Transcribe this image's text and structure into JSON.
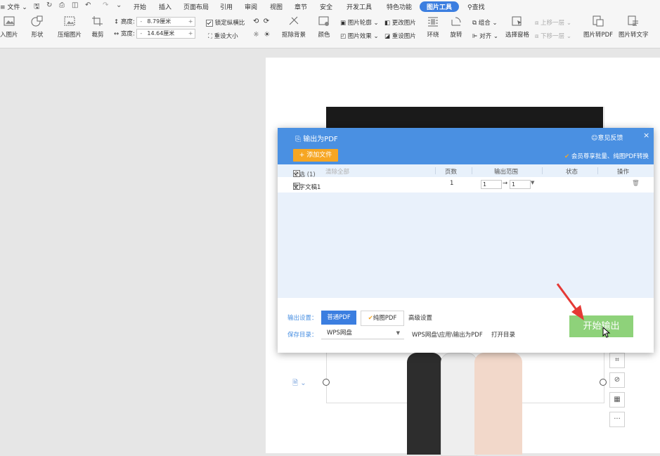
{
  "ribbon": {
    "tabs": [
      {
        "label": "文件"
      },
      {
        "label": "开始"
      },
      {
        "label": "插入"
      },
      {
        "label": "页面布局"
      },
      {
        "label": "引用"
      },
      {
        "label": "审阅"
      },
      {
        "label": "视图"
      },
      {
        "label": "章节"
      },
      {
        "label": "安全"
      },
      {
        "label": "开发工具"
      },
      {
        "label": "特色功能"
      },
      {
        "label": "图片工具"
      }
    ],
    "search_label": "查找",
    "buttons": [
      {
        "label": "入图片"
      },
      {
        "label": "形状"
      },
      {
        "label": "压缩图片"
      },
      {
        "label": "裁剪"
      },
      {
        "label": "抠除背景"
      },
      {
        "label": "颜色"
      },
      {
        "label": "环绕"
      },
      {
        "label": "旋转"
      },
      {
        "label": "选择窗格"
      },
      {
        "label": "图片转PDF"
      },
      {
        "label": "图片转文字"
      }
    ],
    "height_label": "高度:",
    "height_value": "8.79厘米",
    "width_label": "宽度:",
    "width_value": "14.64厘米",
    "lock_ratio_label": "锁定纵横比",
    "reset_size_label": "重设大小",
    "outline_label": "图片轮廓",
    "effect_label": "图片效果",
    "change_label": "更改图片",
    "reset_picture_label": "重设图片",
    "group_label": "组合",
    "align_label": "对齐",
    "up_layer_label": "上移一层",
    "down_layer_label": "下移一层"
  },
  "dialog": {
    "title": "输出为PDF",
    "feedback": "意见反馈",
    "close": "×",
    "add_file": "+ 添加文件",
    "vip_text": "会员尊享批量、纯图PDF转换",
    "table_header": {
      "select_all": "全选 (1)",
      "clear_all": "清除全部",
      "pages": "页数",
      "range": "输出范围",
      "status": "状态",
      "action": "操作"
    },
    "rows": [
      {
        "name": "文字文稿1",
        "pages": "1",
        "from": "1",
        "arrow": "→",
        "to": "1"
      }
    ],
    "output_settings_label": "输出设置：",
    "normal_pdf": "普通PDF",
    "pure_pdf": "纯图PDF",
    "advanced": "高级设置",
    "save_dir_label": "保存目录：",
    "save_location": "WPS网盘",
    "save_path": "WPS网盘\\应用\\输出为PDF",
    "open_dir": "打开目录",
    "start_button": "开始输出"
  },
  "side_tools": {
    "more": "···"
  },
  "colors": {
    "dialog_header": "#4a90e2",
    "add_file": "#f6a623",
    "start_button": "#8ed27a",
    "active_tab": "#3b7ee0",
    "annotation_arrow": "#e53935"
  }
}
